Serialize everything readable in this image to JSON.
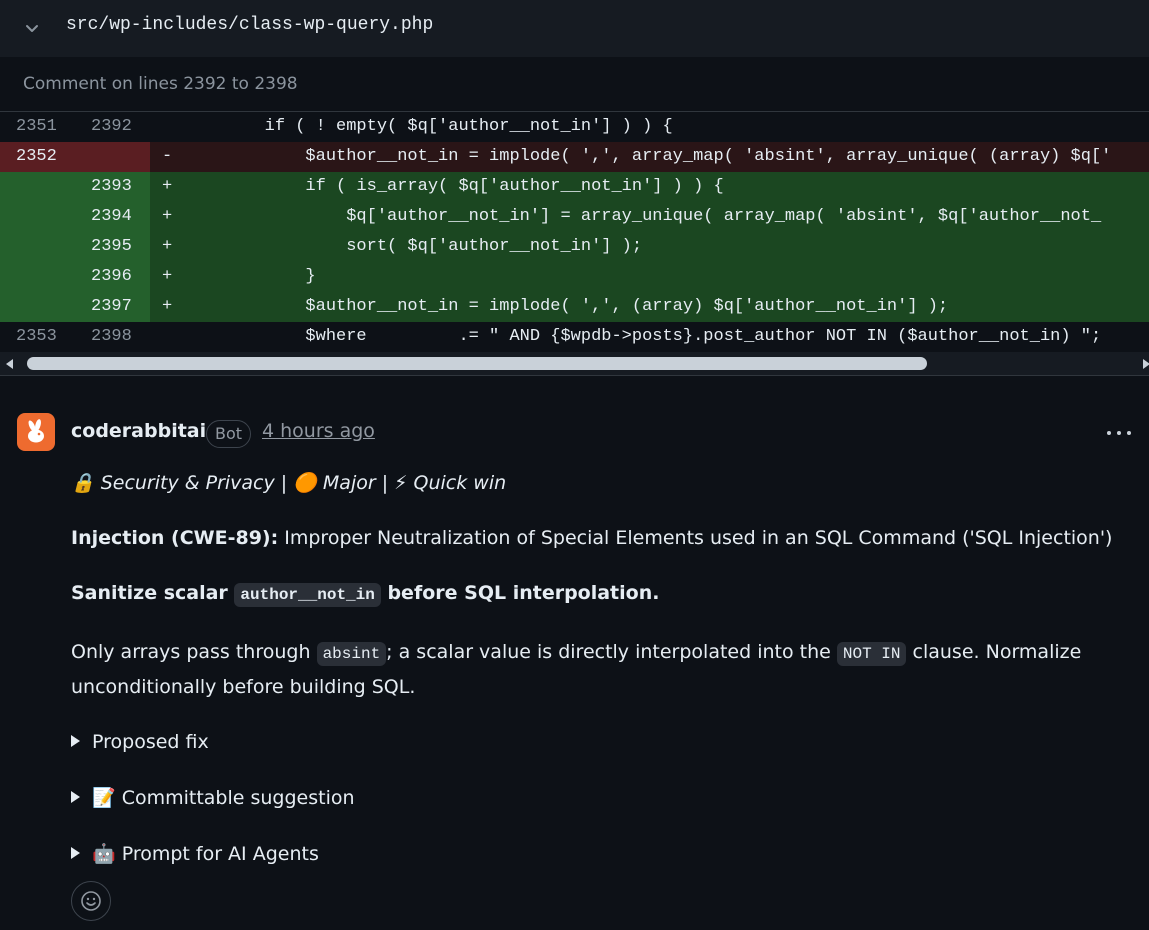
{
  "file": {
    "path": "src/wp-includes/class-wp-query.php",
    "comment_range": "Comment on lines 2392 to 2398"
  },
  "diff": [
    {
      "type": "ctx",
      "old": "2351",
      "new": "2392",
      "sign": "",
      "code": "        if ( ! empty( $q['author__not_in'] ) ) {"
    },
    {
      "type": "del",
      "old": "2352",
      "new": "",
      "sign": "-",
      "code": "            $author__not_in = implode( ',', array_map( 'absint', array_unique( (array) $q['"
    },
    {
      "type": "add",
      "old": "",
      "new": "2393",
      "sign": "+",
      "code": "            if ( is_array( $q['author__not_in'] ) ) {"
    },
    {
      "type": "add",
      "old": "",
      "new": "2394",
      "sign": "+",
      "code": "                $q['author__not_in'] = array_unique( array_map( 'absint', $q['author__not_"
    },
    {
      "type": "add",
      "old": "",
      "new": "2395",
      "sign": "+",
      "code": "                sort( $q['author__not_in'] );"
    },
    {
      "type": "add",
      "old": "",
      "new": "2396",
      "sign": "+",
      "code": "            }"
    },
    {
      "type": "add",
      "old": "",
      "new": "2397",
      "sign": "+",
      "code": "            $author__not_in = implode( ',', (array) $q['author__not_in'] );"
    },
    {
      "type": "ctx",
      "old": "2353",
      "new": "2398",
      "sign": "",
      "code": "            $where         .= \" AND {$wpdb->posts}.post_author NOT IN ($author__not_in) \";"
    }
  ],
  "comment": {
    "author": "coderabbitai",
    "badge": "Bot",
    "time": "4 hours ago",
    "tags": "🔒 Security & Privacy | 🟠 Major | ⚡ Quick win",
    "injection_label": "Injection (CWE-89):",
    "injection_text": " Improper Neutralization of Special Elements used in an SQL Command ('SQL Injection')",
    "heading_pre": "Sanitize scalar ",
    "heading_code": "author__not_in",
    "heading_post": " before SQL interpolation.",
    "body_1": "Only arrays pass through ",
    "body_code_1": "absint",
    "body_2": "; a scalar value is directly interpolated into the ",
    "body_code_2": "NOT IN",
    "body_3": " clause. Normalize",
    "body_line2": "unconditionally before building SQL.",
    "details": [
      "Proposed fix",
      "📝 Committable suggestion",
      "🤖 Prompt for AI Agents"
    ]
  },
  "colors": {
    "accent_orange": "#ee6b2f",
    "add_bg": "#1b4721",
    "del_bg": "#2a1517"
  }
}
